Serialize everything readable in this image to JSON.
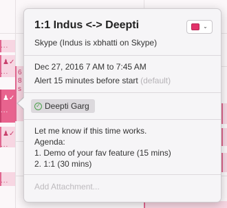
{
  "event": {
    "title": "1:1 Indus <-> Deepti",
    "location": "Skype (Indus is xbhatti on Skype)",
    "datetime": "Dec 27, 2016  7 AM to 7:45 AM",
    "alert_text": "Alert 15 minutes before start",
    "alert_default": "(default)",
    "calendar_color": "#e2326a"
  },
  "attendees": [
    {
      "name": "Deepti Garg",
      "status_icon": "check-circle-icon"
    }
  ],
  "notes": {
    "lines": [
      "Let me know if this time works.",
      "Agenda:",
      "1. Demo of your fav feature (15 mins)",
      "2. 1:1 (30 mins)"
    ]
  },
  "attachments": {
    "placeholder": "Add Attachment..."
  },
  "background": {
    "fragments": [
      "6",
      "8",
      "s"
    ]
  }
}
